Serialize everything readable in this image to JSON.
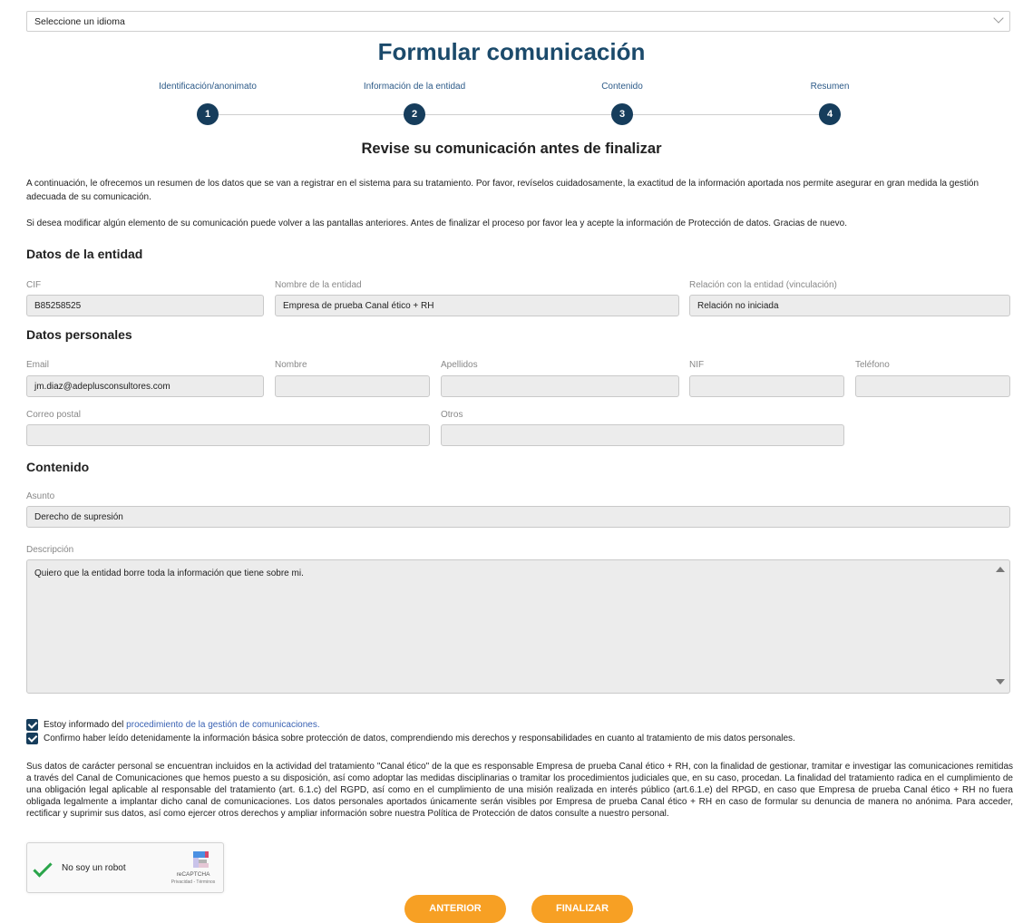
{
  "language": {
    "placeholder": "Seleccione un idioma"
  },
  "title": "Formular comunicación",
  "steps": [
    {
      "label": "Identificación/anonimato",
      "number": "1"
    },
    {
      "label": "Información de la entidad",
      "number": "2"
    },
    {
      "label": "Contenido",
      "number": "3"
    },
    {
      "label": "Resumen",
      "number": "4"
    }
  ],
  "review_heading": "Revise su comunicación antes de finalizar",
  "intro": [
    "A continuación, le ofrecemos un resumen de los datos que se van a registrar en el sistema para su tratamiento. Por favor, revíselos cuidadosamente, la exactitud de la información aportada nos permite asegurar en gran medida la gestión adecuada de su comunicación.",
    "Si desea modificar algún elemento de su comunicación puede volver a las pantallas anteriores. Antes de finalizar el proceso por favor lea y acepte la información de Protección de datos. Gracias de nuevo."
  ],
  "entity": {
    "section": "Datos de la entidad",
    "cif_label": "CIF",
    "cif": "B85258525",
    "name_label": "Nombre de la entidad",
    "name": "Empresa de prueba Canal ético + RH",
    "relation_label": "Relación con la entidad (vinculación)",
    "relation": "Relación no iniciada"
  },
  "personal": {
    "section": "Datos personales",
    "email_label": "Email",
    "email": "jm.diaz@adeplusconsultores.com",
    "nombre_label": "Nombre",
    "nombre": "",
    "apellidos_label": "Apellidos",
    "apellidos": "",
    "nif_label": "NIF",
    "nif": "",
    "telefono_label": "Teléfono",
    "telefono": "",
    "correo_label": "Correo postal",
    "correo": "",
    "otros_label": "Otros",
    "otros": ""
  },
  "content": {
    "section": "Contenido",
    "asunto_label": "Asunto",
    "asunto": "Derecho de supresión",
    "descripcion_label": "Descripción",
    "descripcion": "Quiero que la entidad borre toda la información que tiene sobre mi."
  },
  "checks": {
    "informed_prefix": "Estoy informado del ",
    "informed_link": "procedimiento de la gestión de comunicaciones.",
    "confirm": "Confirmo haber leído detenidamente la información básica sobre protección de datos, comprendiendo mis derechos y responsabilidades en cuanto al tratamiento de mis datos personales."
  },
  "privacy": "Sus datos de carácter personal se encuentran incluidos en la actividad del tratamiento \"Canal ético\" de la que es responsable Empresa de prueba Canal ético + RH, con la finalidad de gestionar, tramitar e investigar las comunicaciones remitidas a través del Canal de Comunicaciones que hemos puesto a su disposición, así como adoptar las medidas disciplinarias o tramitar los procedimientos judiciales que, en su caso, procedan. La finalidad del tratamiento radica en el cumplimiento de una obligación legal aplicable al responsable del tratamiento (art. 6.1.c) del RGPD, así como en el cumplimiento de una misión realizada en interés público (art.6.1.e) del RPGD, en caso que Empresa de prueba Canal ético + RH no fuera obligada legalmente a implantar dicho canal de comunicaciones. Los datos personales aportados únicamente serán visibles por Empresa de prueba Canal ético + RH en caso de formular su denuncia de manera no anónima. Para acceder, rectificar y suprimir sus datos, así como ejercer otros derechos y ampliar información sobre nuestra Política de Protección de datos consulte a nuestro personal.",
  "recaptcha": {
    "label": "No soy un robot",
    "brand": "reCAPTCHA",
    "terms": "Privacidad - Términos"
  },
  "buttons": {
    "prev": "ANTERIOR",
    "finish": "FINALIZAR"
  },
  "colors": {
    "primary": "#163d5c",
    "accent": "#f7a024",
    "link": "#3a62b3"
  }
}
